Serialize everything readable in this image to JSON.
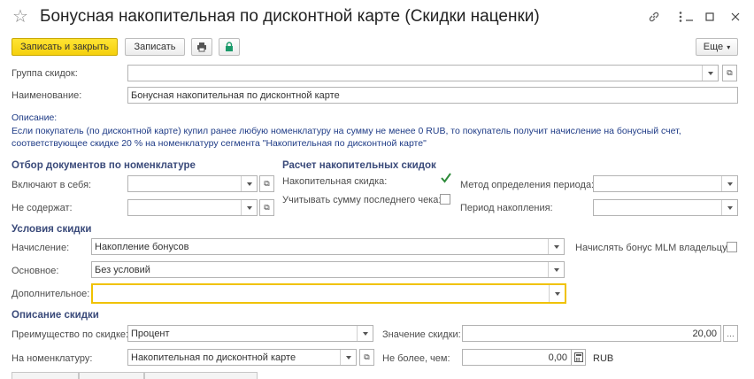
{
  "window": {
    "title": "Бонусная накопительная по дисконтной карте (Скидки наценки)",
    "icons": [
      "star-icon",
      "link-icon",
      "more-icon",
      "minimize-icon",
      "maximize-icon",
      "close-icon"
    ]
  },
  "toolbar": {
    "save_close": "Записать и закрыть",
    "save": "Записать",
    "more": "Еще"
  },
  "form": {
    "group_label": "Группа скидок:",
    "group_value": "",
    "name_label": "Наименование:",
    "name_value": "Бонусная накопительная по дисконтной карте",
    "description_label": "Описание:",
    "description_line1": "Если покупатель (по дисконтной карте) купил ранее любую номенклатуру на сумму не менее 0 RUB, то покупатель получит начисление на бонусный счет,",
    "description_line2": "соответствующее скидке 20 % на номенклатуру сегмента \"Накопительная по дисконтной карте\""
  },
  "filter": {
    "title": "Отбор документов по номенклатуре",
    "include_label": "Включают в себя:",
    "include_value": "",
    "exclude_label": "Не содержат:",
    "exclude_value": ""
  },
  "calc": {
    "title": "Расчет накопительных скидок",
    "cumulative_label": "Накопительная скидка:",
    "cumulative_checked": true,
    "last_check_label": "Учитывать сумму последнего чека:",
    "last_check_checked": false,
    "period_method_label": "Метод определения периода:",
    "period_method_value": "",
    "period_label": "Период накопления:",
    "period_value": ""
  },
  "conditions": {
    "title": "Условия скидки",
    "accrual_label": "Начисление:",
    "accrual_value": "Накопление бонусов",
    "mlm_label": "Начислять бонус MLM владельцу:",
    "mlm_checked": false,
    "main_label": "Основное:",
    "main_value": "Без условий",
    "extra_label": "Дополнительное:",
    "extra_value": ""
  },
  "discount": {
    "title": "Описание скидки",
    "advantage_label": "Преимущество по скидке:",
    "advantage_value": "Процент",
    "value_label": "Значение скидки:",
    "value_value": "20,00",
    "nomenclature_label": "На номенклатуру:",
    "nomenclature_value": "Накопительная по дисконтной карте",
    "max_label": "Не более, чем:",
    "max_value": "0,00",
    "currency": "RUB"
  },
  "colors": {
    "primary_button": "#f5d00d",
    "section_title": "#3a4a7a",
    "description_text": "#1e3b86",
    "checkmark": "#2e8b3a",
    "focus_border": "#f0c200"
  }
}
